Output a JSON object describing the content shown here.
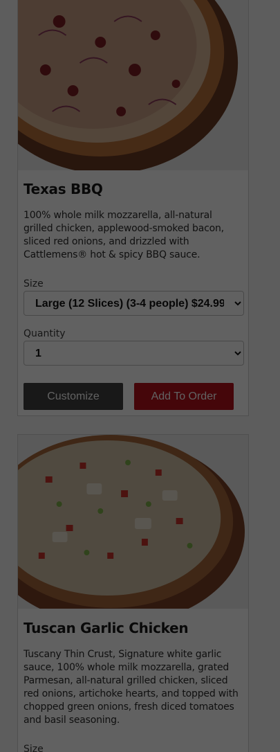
{
  "products": [
    {
      "title": "Texas BBQ",
      "description": "100% whole milk mozzarella, all-natural grilled chicken, applewood-smoked bacon, sliced red onions, and drizzled with Cattlemens® hot & spicy BBQ sauce.",
      "size_label": "Size",
      "size_value": "Large (12 Slices) (3-4 people) $24.99",
      "quantity_label": "Quantity",
      "quantity_value": "1",
      "customize_label": "Customize",
      "add_label": "Add To Order"
    },
    {
      "title": "Tuscan Garlic Chicken",
      "description": "Tuscany Thin Crust, Signature white garlic sauce, 100% whole milk mozzarella, grated Parmesan, all-natural grilled chicken, sliced red onions, artichoke hearts, and topped with chopped green onions, fresh diced tomatoes and basil seasoning.",
      "size_label": "Size"
    }
  ],
  "colors": {
    "overlay": "rgba(0,0,0,0.62)",
    "add_button": "#b5121b",
    "customize_button": "#3f3f3f"
  }
}
